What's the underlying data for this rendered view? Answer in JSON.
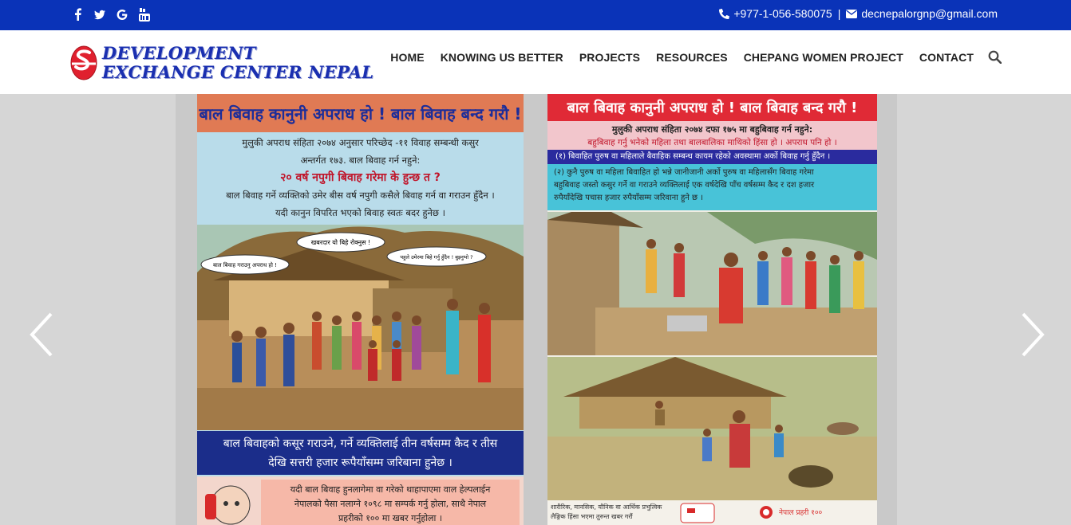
{
  "topbar": {
    "social": [
      {
        "name": "facebook-icon",
        "glyph": "f"
      },
      {
        "name": "twitter-icon",
        "glyph": "t"
      },
      {
        "name": "google-icon",
        "glyph": "G"
      },
      {
        "name": "youtube-icon",
        "glyph": "▶"
      }
    ],
    "phone": "+977-1-056-580075",
    "separator": "|",
    "email": "decnepalorgnp@gmail.com",
    "bg_color": "#0a33b8"
  },
  "logo": {
    "line1": "DEVELOPMENT",
    "line2": "EXCHANGE CENTER NEPAL",
    "brand_color": "#1a2fb0",
    "mark_color": "#e0202e"
  },
  "nav": {
    "items": [
      {
        "label": "HOME"
      },
      {
        "label": "KNOWING US BETTER"
      },
      {
        "label": "PROJECTS"
      },
      {
        "label": "RESOURCES"
      },
      {
        "label": "CHEPANG WOMEN PROJECT"
      },
      {
        "label": "CONTACT"
      }
    ],
    "search_icon": "search-icon"
  },
  "slider": {
    "prev_icon": "chevron-left-icon",
    "next_icon": "chevron-right-icon",
    "poster1": {
      "banner": "बाल बिवाह कानुनी अपराध हो ! बाल बिवाह बन्द गरौ !",
      "line1": "मुलुकी अपराध संहिता २०७४ अनुसार परिच्छेद -११ विवाह सम्बन्धी कसुर",
      "line2": "अन्तर्गत १७३. बाल बिवाह गर्न नहुने:",
      "headline": "२० वर्ष नपुगी बिवाह गरेमा के हुन्छ त ?",
      "line3": "बाल बिवाह गर्ने व्यक्तिको उमेर बीस वर्ष नपुगी कसैले बिवाह गर्न वा गराउन हुँदैन ।",
      "line4": "यदी कानुन विपरित भएको बिवाह स्वतः बदर हुनेछ ।",
      "bubble1": "बाल बिवाह गराउनु अपराध हो !",
      "bubble2": "खबरदार यो बिहे रोक्नुस !",
      "bubble3": "पहुले उमेरमा बिहे गर्नु हुँदैन ! बुझ्नुभो ?",
      "bottom1": "बाल बिवाहको कसूर गराउने, गर्ने व्यक्तिलाई तीन वर्षसम्म कैद र तीस",
      "bottom2": "देखि सत्तरी हजार रूपैयाँसम्म जरिबाना हुनेछ ।",
      "help1": "यदी बाल बिवाह हुनलागेमा वा गरेको थाहापाएमा वाल हेल्पलाईन",
      "help2": "नेपालको पैसा नलाग्ने १०९८ मा सम्पर्क गर्नु होला, साथै नेपाल",
      "help3": "प्रहरीको १०० मा खबर गर्नुहोला ।"
    },
    "poster2": {
      "banner": "बाल बिवाह कानुनी अपराध हो ! बाल बिवाह बन्द गरौ !",
      "sub1": "मुलुकी अपराध संहिता २०७४ दफा १७५ मा बहुबिवाह गर्न नहुने:",
      "sub2": "बहुबिवाह गर्नु भनेको महिला तथा बालबालिका माथिको हिंसा हो । अपराध पनि हो ।",
      "blue": "(१)  बिवाहित पुरुष वा महिलाले बैवाहिक सम्बन्ध कायम रहेको अवस्थामा अर्को बिवाह गर्नु हुँदैन ।",
      "cyan1": "(२) कुनै पुरुष वा महिला बिवाहित हो भन्ने जानीजानी अर्को पुरुष वा महिलासँग बिवाह गरेमा",
      "cyan2": "बहुबिवाह जस्तो कसुर गर्ने वा गराउने व्यक्तिलाई एक वर्षदेखि पाँच वर्षसम्म कैद र दश हजार",
      "cyan3": "रुपैयाँदेखि पचास हजार रुपैयाँसम्म जरिवाना हुने छ ।",
      "footer1": "शारीरिक, मानसिक, यौनिक वा आर्थिक प्रभुत्विक",
      "footer2": "लैङ्गिक हिंसा भएमा तुरुन्त खबर गरौं",
      "footer3": "नेपाल प्रहरी १००"
    }
  }
}
